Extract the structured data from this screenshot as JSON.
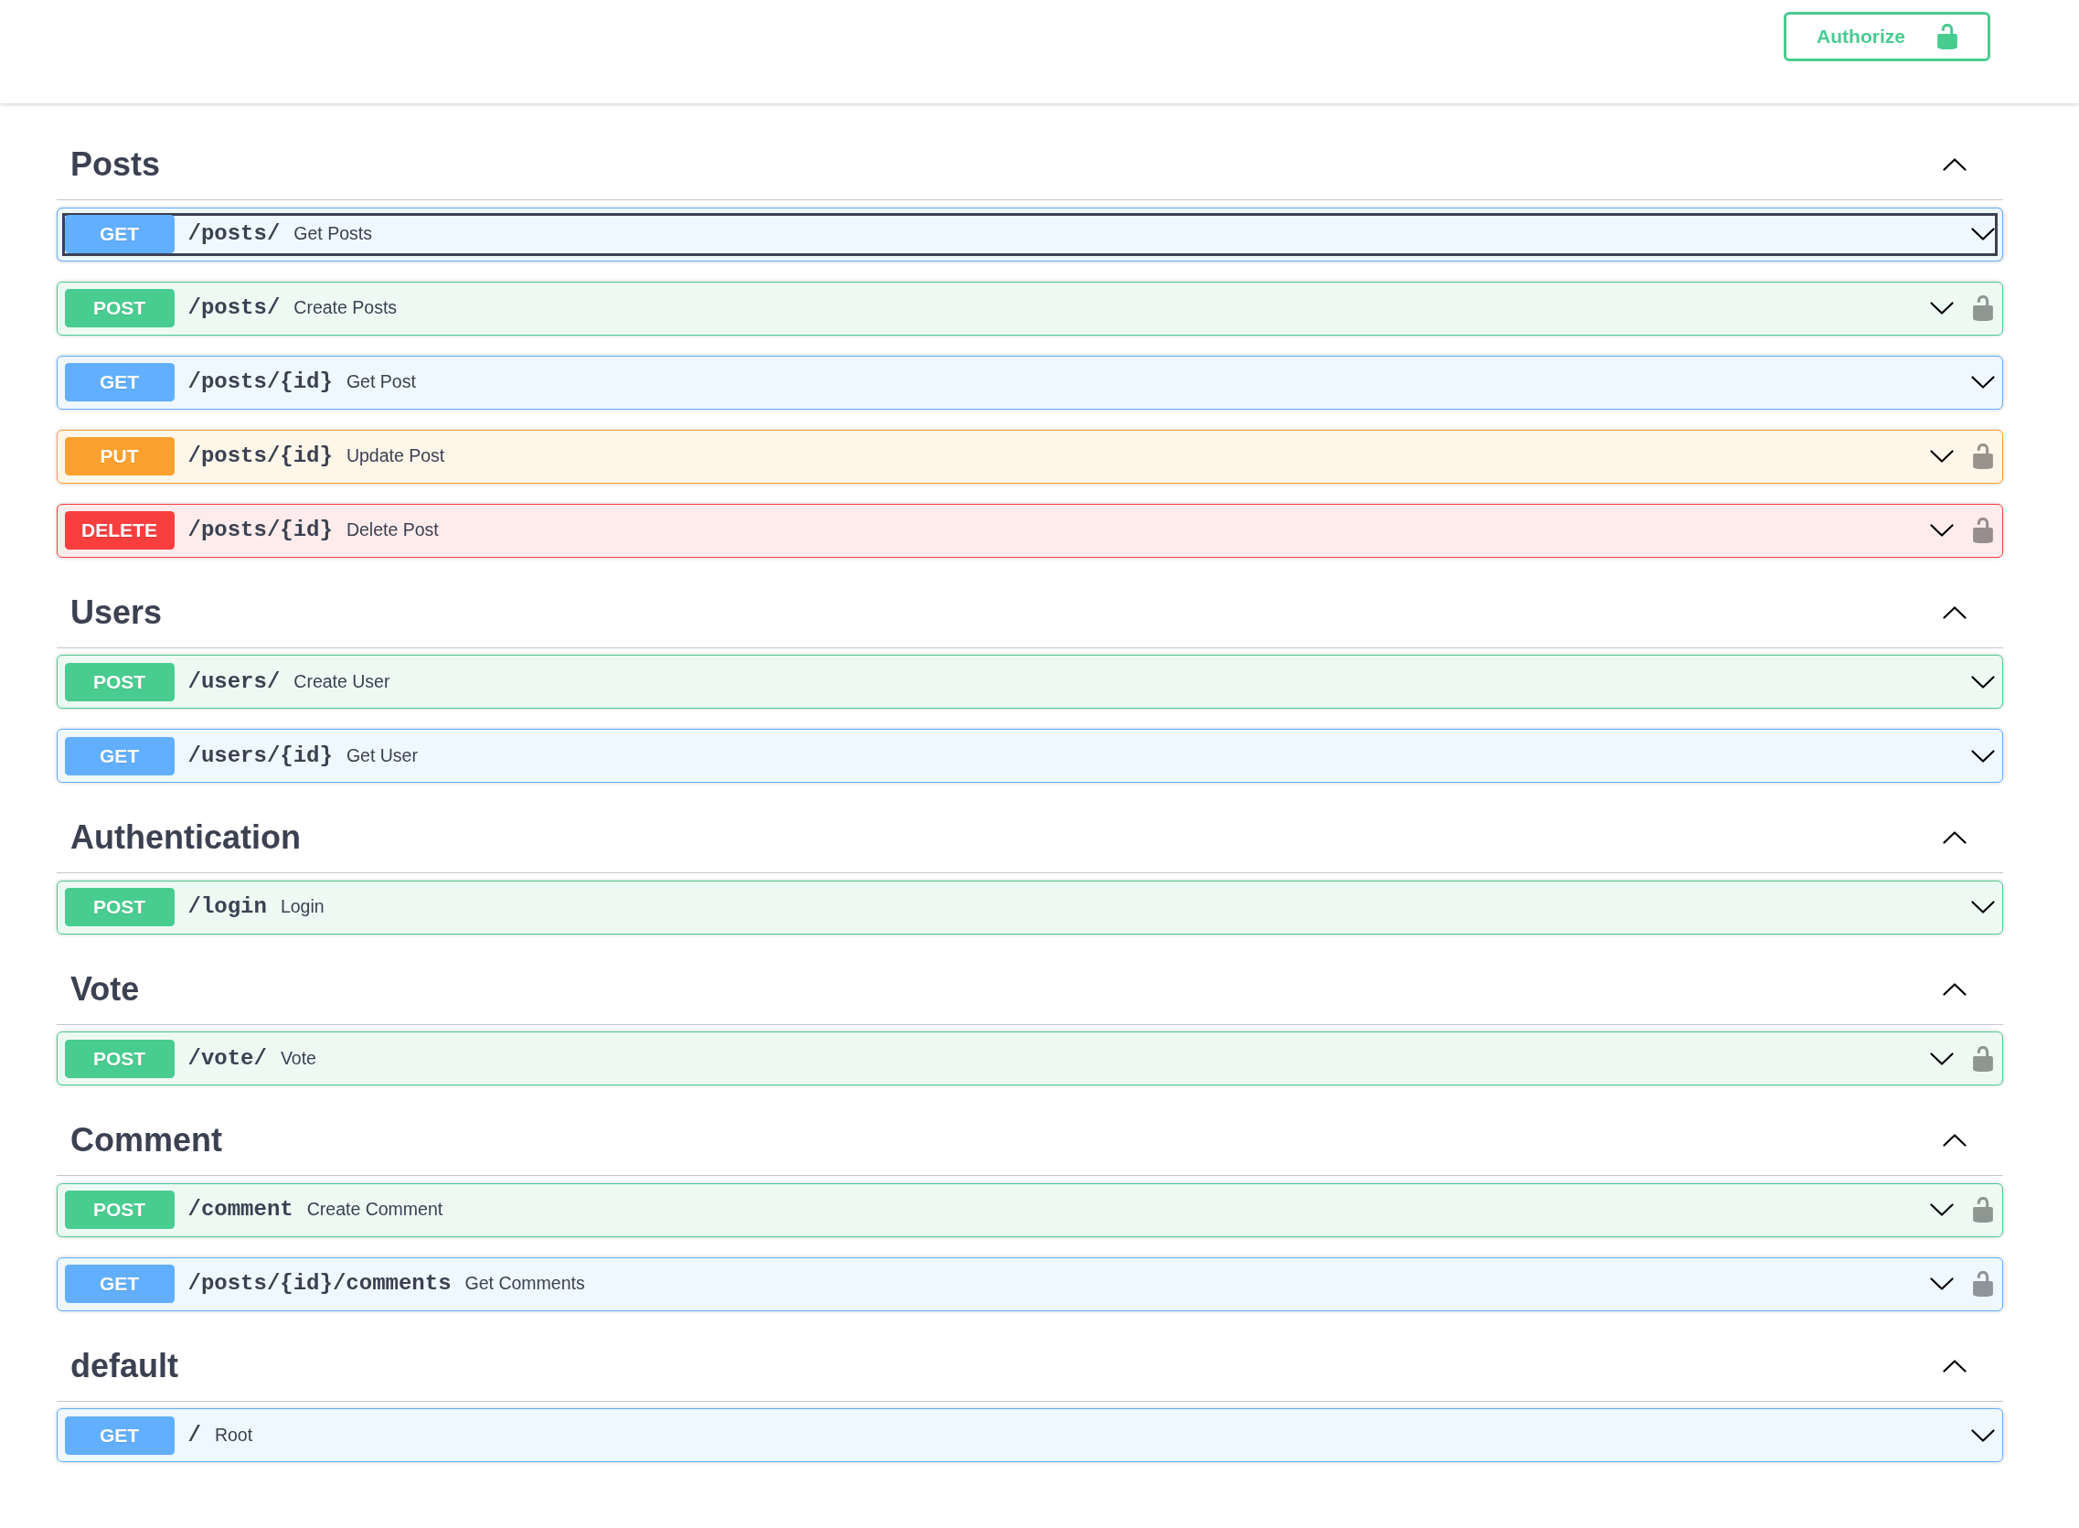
{
  "top_bar": {
    "authorize_button": {
      "label": "Authorize"
    }
  },
  "sections": [
    {
      "title": "Posts",
      "expanded": true,
      "operations": [
        {
          "method": "GET",
          "color": "#61affe",
          "path": "/posts/",
          "summary": "Get Posts",
          "expanded": false,
          "focused": true,
          "auth_lock": false
        },
        {
          "method": "POST",
          "color": "#49cc90",
          "path": "/posts/",
          "summary": "Create Posts",
          "expanded": false,
          "focused": false,
          "auth_lock": true
        },
        {
          "method": "GET",
          "color": "#61affe",
          "path": "/posts/{id}",
          "summary": "Get Post",
          "expanded": false,
          "focused": false,
          "auth_lock": false
        },
        {
          "method": "PUT",
          "color": "#fca130",
          "path": "/posts/{id}",
          "summary": "Update Post",
          "expanded": false,
          "focused": false,
          "auth_lock": true
        },
        {
          "method": "DELETE",
          "color": "#f93e3e",
          "path": "/posts/{id}",
          "summary": "Delete Post",
          "expanded": false,
          "focused": false,
          "auth_lock": true
        }
      ]
    },
    {
      "title": "Users",
      "expanded": true,
      "operations": [
        {
          "method": "POST",
          "color": "#49cc90",
          "path": "/users/",
          "summary": "Create User",
          "expanded": false,
          "focused": false,
          "auth_lock": false
        },
        {
          "method": "GET",
          "color": "#61affe",
          "path": "/users/{id}",
          "summary": "Get User",
          "expanded": false,
          "focused": false,
          "auth_lock": false
        }
      ]
    },
    {
      "title": "Authentication",
      "expanded": true,
      "operations": [
        {
          "method": "POST",
          "color": "#49cc90",
          "path": "/login",
          "summary": "Login",
          "expanded": false,
          "focused": false,
          "auth_lock": false
        }
      ]
    },
    {
      "title": "Vote",
      "expanded": true,
      "operations": [
        {
          "method": "POST",
          "color": "#49cc90",
          "path": "/vote/",
          "summary": "Vote",
          "expanded": false,
          "focused": false,
          "auth_lock": true
        }
      ]
    },
    {
      "title": "Comment",
      "expanded": true,
      "operations": [
        {
          "method": "POST",
          "color": "#49cc90",
          "path": "/comment",
          "summary": "Create Comment",
          "expanded": false,
          "focused": false,
          "auth_lock": true
        },
        {
          "method": "GET",
          "color": "#61affe",
          "path": "/posts/{id}/comments",
          "summary": "Get Comments",
          "expanded": false,
          "focused": false,
          "auth_lock": true
        }
      ]
    },
    {
      "title": "default",
      "expanded": true,
      "operations": [
        {
          "method": "GET",
          "color": "#61affe",
          "path": "/",
          "summary": "Root",
          "expanded": false,
          "focused": false,
          "auth_lock": false
        }
      ]
    }
  ]
}
